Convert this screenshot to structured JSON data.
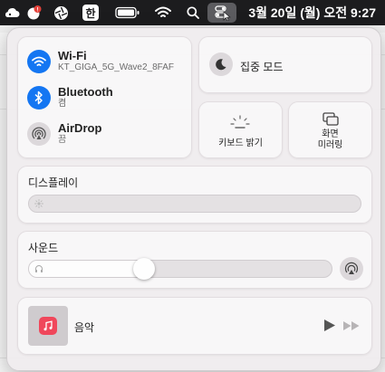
{
  "menubar": {
    "input_method_char": "한",
    "clock": "3월 20일 (월) 오전  9:27"
  },
  "connectivity": {
    "wifi": {
      "title": "Wi-Fi",
      "subtitle": "KT_GIGA_5G_Wave2_8FAF",
      "on": true
    },
    "bluetooth": {
      "title": "Bluetooth",
      "subtitle": "켬",
      "on": true
    },
    "airdrop": {
      "title": "AirDrop",
      "subtitle": "끔",
      "on": false
    }
  },
  "focus": {
    "label": "집중 모드"
  },
  "keyboard_brightness": {
    "label": "키보드 밝기"
  },
  "screen_mirroring": {
    "label_line1": "화면",
    "label_line2": "미러링"
  },
  "display": {
    "title": "디스플레이",
    "brightness": 0
  },
  "sound": {
    "title": "사운드",
    "volume": 0.37
  },
  "now_playing": {
    "app": "음악"
  },
  "colors": {
    "accent": "#1476f2",
    "music_icon": "#f0475b"
  }
}
